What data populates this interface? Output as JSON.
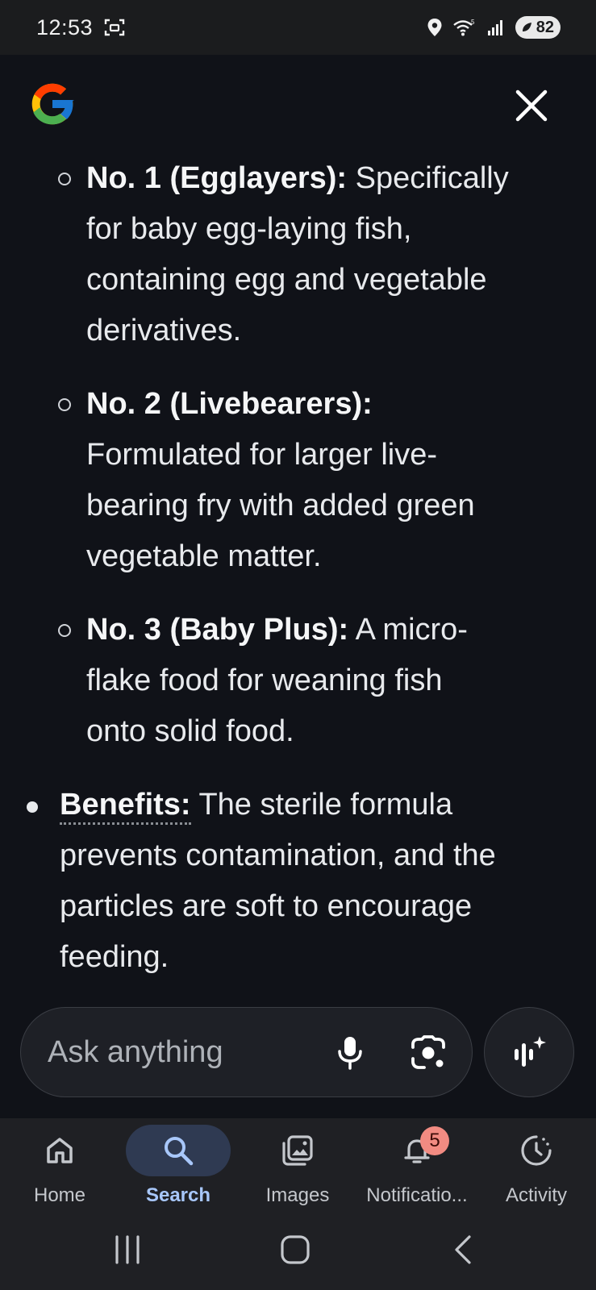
{
  "status_bar": {
    "time": "12:53",
    "battery": "82"
  },
  "content": {
    "sub_items": [
      {
        "bold": "No. 1 (Egglayers):",
        "line1": " Specifically",
        "rest": [
          "for baby egg-laying fish,",
          "containing egg and vegetable",
          "derivatives."
        ]
      },
      {
        "bold": "No. 2 (Livebearers):",
        "line1": "",
        "rest": [
          "Formulated for larger live-",
          "bearing fry with added green",
          "vegetable matter."
        ]
      },
      {
        "bold": "No. 3 (Baby Plus):",
        "line1": " A micro-",
        "rest": [
          "flake food for weaning fish",
          "onto solid food."
        ]
      }
    ],
    "main_item": {
      "bold": "Benefits:",
      "line1": " The sterile formula",
      "rest": [
        "prevents contamination, and the",
        "particles are soft to encourage",
        "feeding."
      ]
    }
  },
  "ask_bar": {
    "placeholder": "Ask anything"
  },
  "bottom_nav": {
    "items": [
      {
        "label": "Home",
        "icon": "home-icon"
      },
      {
        "label": "Search",
        "icon": "search-icon",
        "active": true
      },
      {
        "label": "Images",
        "icon": "images-icon"
      },
      {
        "label": "Notificatio...",
        "icon": "bell-icon",
        "badge": "5"
      },
      {
        "label": "Activity",
        "icon": "activity-icon"
      }
    ]
  },
  "colors": {
    "background": "#101218",
    "active_tab": "#a8c7fa",
    "badge": "#f28b82"
  }
}
